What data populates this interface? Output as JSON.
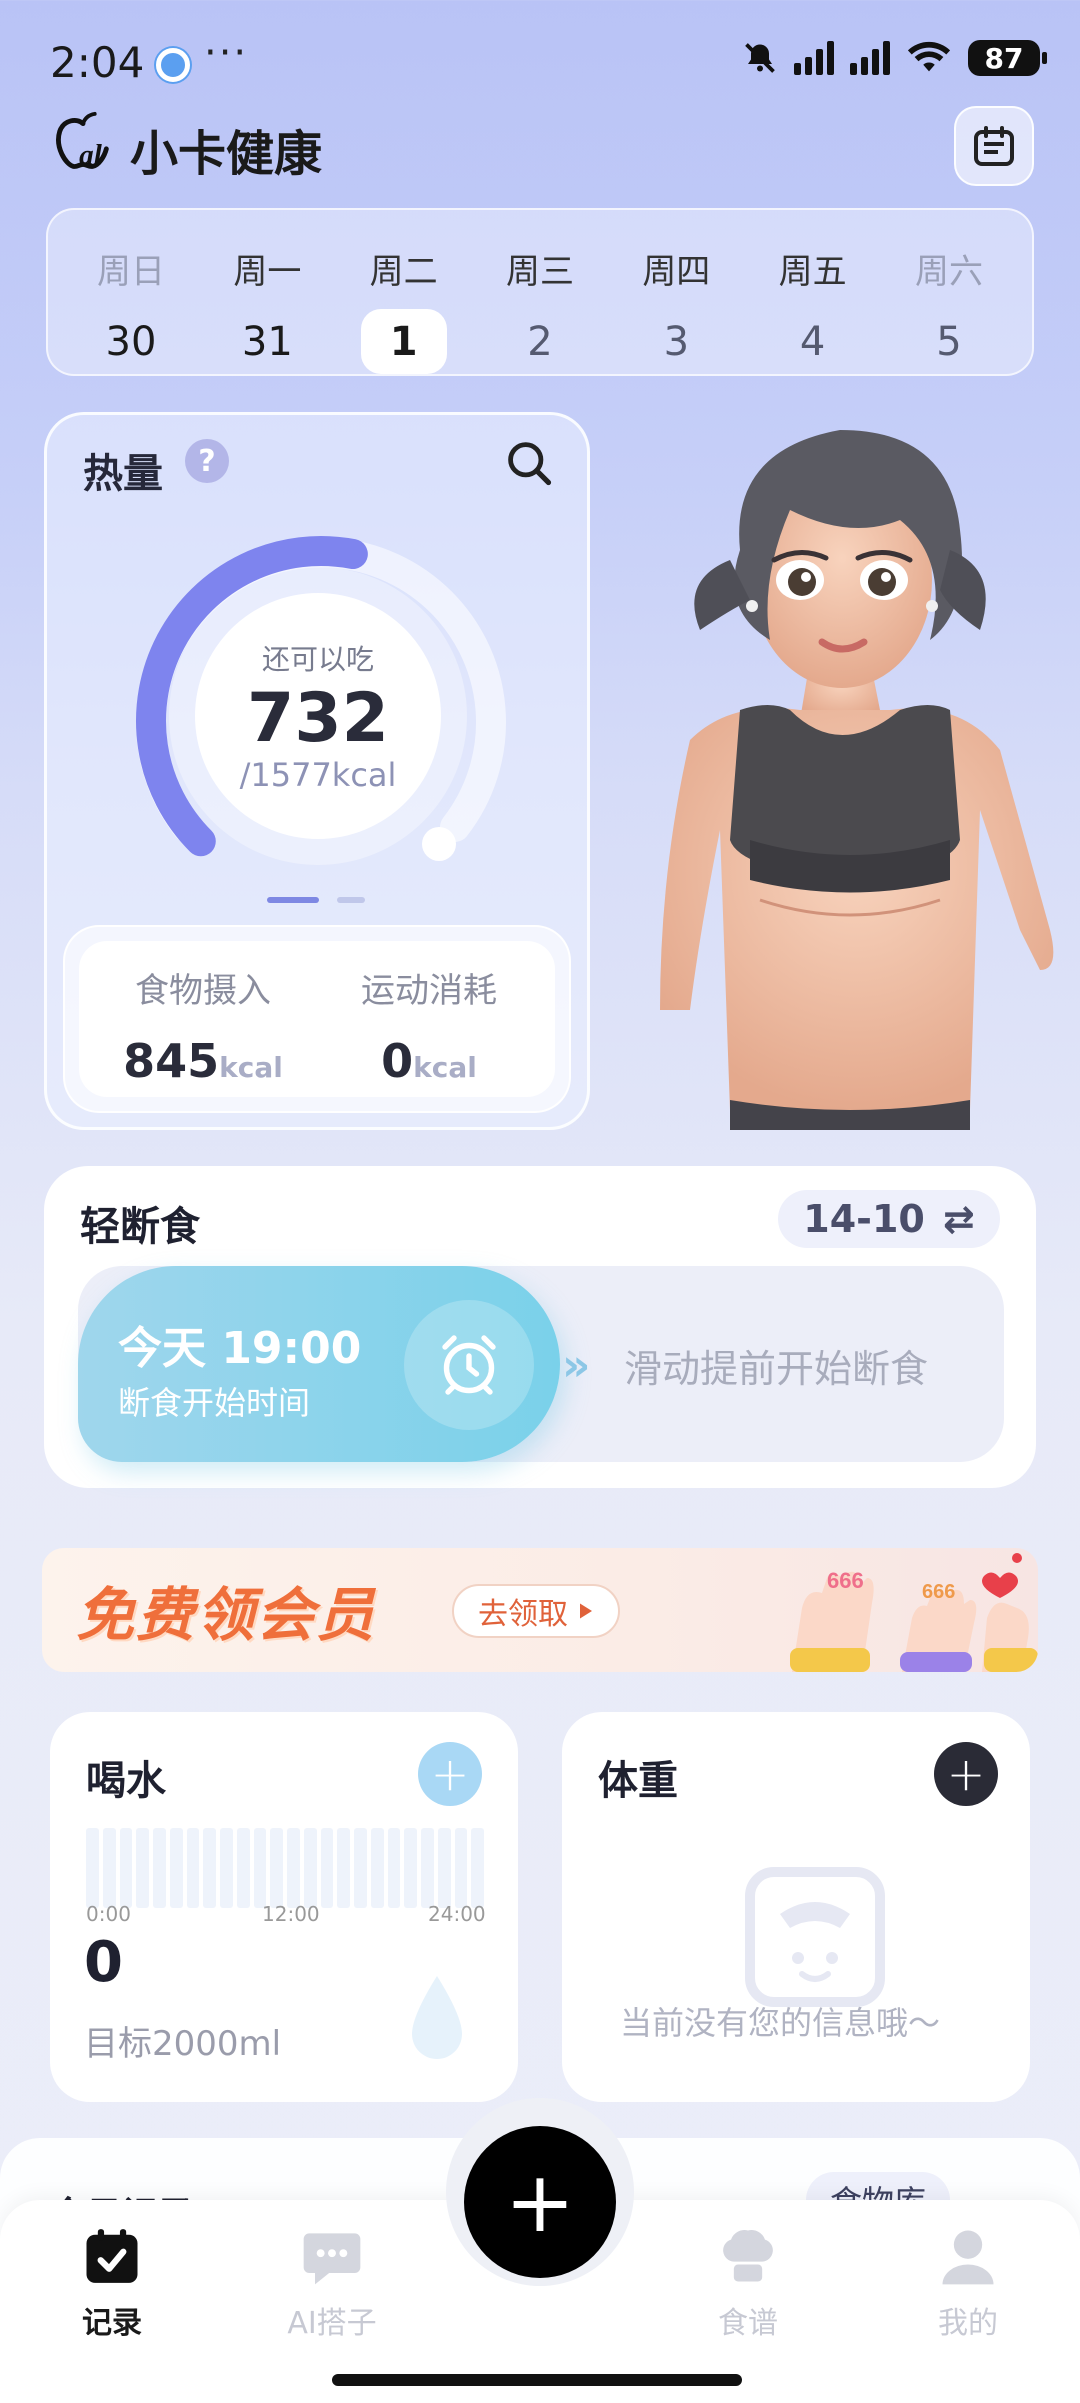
{
  "status_bar": {
    "time": "2:04",
    "more": "···",
    "battery": "87"
  },
  "header": {
    "app_name": "小卡健康"
  },
  "week": [
    {
      "name": "周日",
      "date": "30",
      "state": "muted"
    },
    {
      "name": "周一",
      "date": "31",
      "state": "past"
    },
    {
      "name": "周二",
      "date": "1",
      "state": "active"
    },
    {
      "name": "周三",
      "date": "2",
      "state": "future"
    },
    {
      "name": "周四",
      "date": "3",
      "state": "future"
    },
    {
      "name": "周五",
      "date": "4",
      "state": "future"
    },
    {
      "name": "周六",
      "date": "5",
      "state": "muted"
    }
  ],
  "calories": {
    "title": "热量",
    "help": "?",
    "remain_label": "还可以吃",
    "remain_value": "732",
    "total": "/1577kcal",
    "progress_fraction": 0.54,
    "food_label": "食物摄入",
    "food_value": "845",
    "exercise_label": "运动消耗",
    "exercise_value": "0",
    "unit": "kcal"
  },
  "fasting": {
    "title": "轻断食",
    "plan": "14-10",
    "swap_icon": "⇄",
    "start_time": "今天 19:00",
    "start_label": "断食开始时间",
    "chevrons": "»",
    "slide_hint": "滑动提前开始断食"
  },
  "banner": {
    "text": "免费领会员",
    "button": "去领取"
  },
  "water": {
    "title": "喝水",
    "add": "+",
    "axis": [
      "0:00",
      "12:00",
      "24:00"
    ],
    "value": "0",
    "goal": "目标2000ml"
  },
  "weight": {
    "title": "体重",
    "add": "+",
    "empty": "当前没有您的信息哦～"
  },
  "peek": {
    "title": "今日记录",
    "button": "食物库"
  },
  "tabs": [
    {
      "label": "记录",
      "icon": "calendar-check-icon",
      "active": true
    },
    {
      "label": "AI搭子",
      "icon": "chat-bubble-icon",
      "active": false
    },
    {
      "label": "食谱",
      "icon": "chef-hat-icon",
      "active": false
    },
    {
      "label": "我的",
      "icon": "person-icon",
      "active": false
    }
  ],
  "fab": "+",
  "colors": {
    "accent": "#7e88e3",
    "fast_blue": "#7ad1ea",
    "banner_orange": "#ef6f3b"
  }
}
